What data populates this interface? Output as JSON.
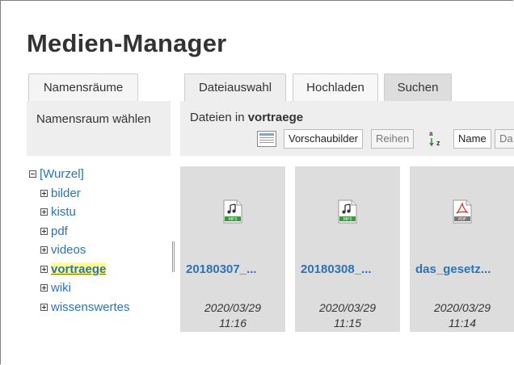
{
  "page": {
    "title": "Medien-Manager"
  },
  "namespaces": {
    "tab_label": "Namensräume",
    "choose_label": "Namensraum wählen",
    "root": "[Wurzel]",
    "items": [
      "bilder",
      "kistu",
      "pdf",
      "videos",
      "vortraege",
      "wiki",
      "wissenswertes"
    ],
    "current": "vortraege"
  },
  "tabs": {
    "files": "Dateiauswahl",
    "upload": "Hochladen",
    "search": "Suchen"
  },
  "files_bar": {
    "caption_prefix": "Dateien in",
    "namespace": "vortraege",
    "view_thumbs": "Vorschaubilder",
    "view_rows": "Reihen",
    "sort_name": "Name",
    "sort_date": "Da"
  },
  "files": [
    {
      "name": "20180307_...",
      "date": "2020/03/29",
      "time": "11:16",
      "type": "MP3"
    },
    {
      "name": "20180308_...",
      "date": "2020/03/29",
      "time": "11:15",
      "type": "MP3"
    },
    {
      "name": "das_gesetz...",
      "date": "2020/03/29",
      "time": "11:14",
      "type": "PDF"
    }
  ],
  "colors": {
    "link": "#2b73b7",
    "panel": "#eeeeee",
    "card": "#dddddd",
    "highlight": "#ffff88",
    "mp3_icon": "#3a9a3a",
    "pdf_icon": "#d23b2b"
  },
  "icons": {
    "mp3": "music-file-icon",
    "pdf": "pdf-file-icon",
    "view": "thumbnail-view-icon",
    "sort": "sort-alpha-icon",
    "tree_open": "minus-box-icon",
    "tree_closed": "plus-box-icon"
  }
}
